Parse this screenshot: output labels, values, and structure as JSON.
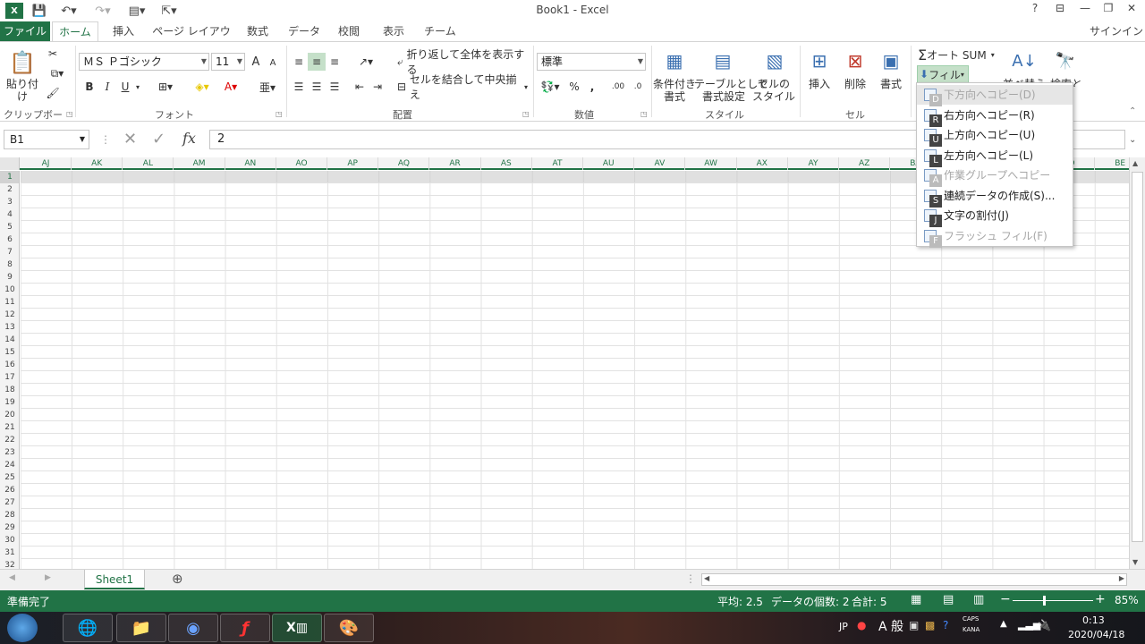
{
  "window": {
    "title": "Book1 - Excel",
    "help": "?",
    "signin": "サインイン"
  },
  "tabs": [
    "ファイル",
    "ホーム",
    "挿入",
    "ページ レイアウト",
    "数式",
    "データ",
    "校閲",
    "表示",
    "チーム"
  ],
  "ribbon": {
    "clipboard": {
      "paste_label": "貼り付け",
      "group_label": "クリップボード"
    },
    "font": {
      "font_name": "ＭＳ Ｐゴシック",
      "font_size": "11",
      "bold": "B",
      "italic": "I",
      "underline": "U",
      "grow": "A",
      "shrink": "A",
      "group_label": "フォント"
    },
    "alignment": {
      "wrap_text": "折り返して全体を表示する",
      "merge_center": "セルを結合して中央揃え",
      "group_label": "配置"
    },
    "number": {
      "format": "標準",
      "percent": "%",
      "comma": ",",
      "group_label": "数値"
    },
    "styles": {
      "conditional": "条件付き\n書式",
      "table": "テーブルとして\n書式設定",
      "cell_styles": "セルの\nスタイル",
      "group_label": "スタイル"
    },
    "cells": {
      "insert": "挿入",
      "delete": "削除",
      "format": "書式",
      "group_label": "セル"
    },
    "editing": {
      "autosum": "オート SUM",
      "fill": "フィル",
      "sort": "並べ替え",
      "find": "検索と"
    }
  },
  "formula_bar": {
    "name_box": "B1",
    "cancel": "✕",
    "enter": "✓",
    "fx": "fx",
    "value": "2"
  },
  "columns": [
    "AJ",
    "AK",
    "AL",
    "AM",
    "AN",
    "AO",
    "AP",
    "AQ",
    "AR",
    "AS",
    "AT",
    "AU",
    "AV",
    "AW",
    "AX",
    "AY",
    "AZ",
    "BA",
    "BB",
    "BC",
    "BD",
    "BE"
  ],
  "rows": [
    "1",
    "2",
    "3",
    "4",
    "5",
    "6",
    "7",
    "8",
    "9",
    "10",
    "11",
    "12",
    "13",
    "14",
    "15",
    "16",
    "17",
    "18",
    "19",
    "20",
    "21",
    "22",
    "23",
    "24",
    "25",
    "26",
    "27",
    "28",
    "29",
    "30",
    "31",
    "32"
  ],
  "fill_menu": [
    {
      "label": "下方向へコピー(D)",
      "key": "D",
      "disabled": true
    },
    {
      "label": "右方向へコピー(R)",
      "key": "R",
      "disabled": false
    },
    {
      "label": "上方向へコピー(U)",
      "key": "U",
      "disabled": false
    },
    {
      "label": "左方向へコピー(L)",
      "key": "L",
      "disabled": false
    },
    {
      "label": "作業グループへコピー(A)...",
      "key": "A",
      "disabled": true
    },
    {
      "label": "連続データの作成(S)...",
      "key": "S",
      "disabled": false
    },
    {
      "label": "文字の割付(J)",
      "key": "J",
      "disabled": false
    },
    {
      "label": "フラッシュ フィル(F)",
      "key": "F",
      "disabled": true
    }
  ],
  "sheet": {
    "tab": "Sheet1",
    "add": "⊕"
  },
  "status": {
    "ready": "準備完了",
    "average": "平均: 2.5",
    "count": "データの個数: 2",
    "sum": "合計: 5",
    "zoom": "85%"
  },
  "taskbar": {
    "ime_lang": "JP",
    "ime_mode": "A 般",
    "caps": "CAPS",
    "kana": "KANA",
    "time": "0:13",
    "date": "2020/04/18"
  },
  "colors": {
    "accent": "#217346"
  }
}
